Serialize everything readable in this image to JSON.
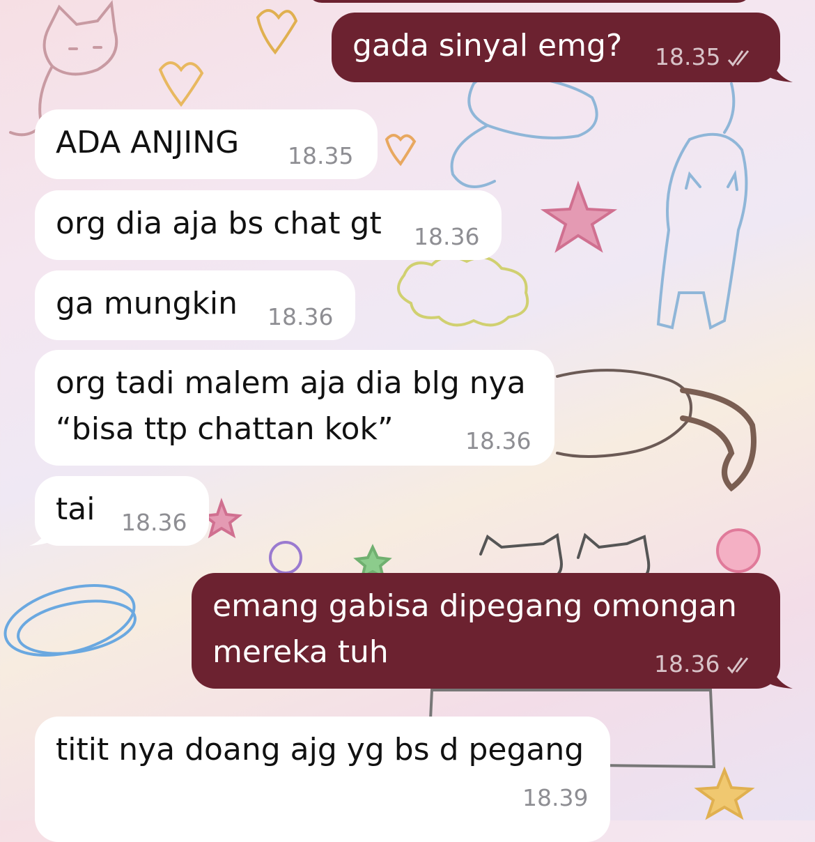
{
  "theme": {
    "incoming_color": "#ffffff",
    "outgoing_color": "#6c2230"
  },
  "messages": [
    {
      "direction": "outgoing",
      "lines": [
        "gada sinyal emg?"
      ],
      "time": "18.35",
      "status": "read-double-check-icon"
    },
    {
      "direction": "incoming",
      "lines": [
        "ADA ANJING"
      ],
      "time": "18.35"
    },
    {
      "direction": "incoming",
      "lines": [
        "org dia aja bs chat gt"
      ],
      "time": "18.36"
    },
    {
      "direction": "incoming",
      "lines": [
        "ga mungkin"
      ],
      "time": "18.36"
    },
    {
      "direction": "incoming",
      "lines": [
        "org tadi malem aja dia blg nya",
        "“bisa ttp chattan kok”"
      ],
      "time": "18.36"
    },
    {
      "direction": "incoming",
      "lines": [
        "tai"
      ],
      "time": "18.36"
    },
    {
      "direction": "outgoing",
      "lines": [
        "emang gabisa dipegang omongan",
        "mereka tuh"
      ],
      "time": "18.36",
      "status": "read-double-check-icon"
    },
    {
      "direction": "incoming",
      "lines": [
        "titit nya doang ajg yg bs d pegang"
      ],
      "time": "18.39"
    }
  ]
}
